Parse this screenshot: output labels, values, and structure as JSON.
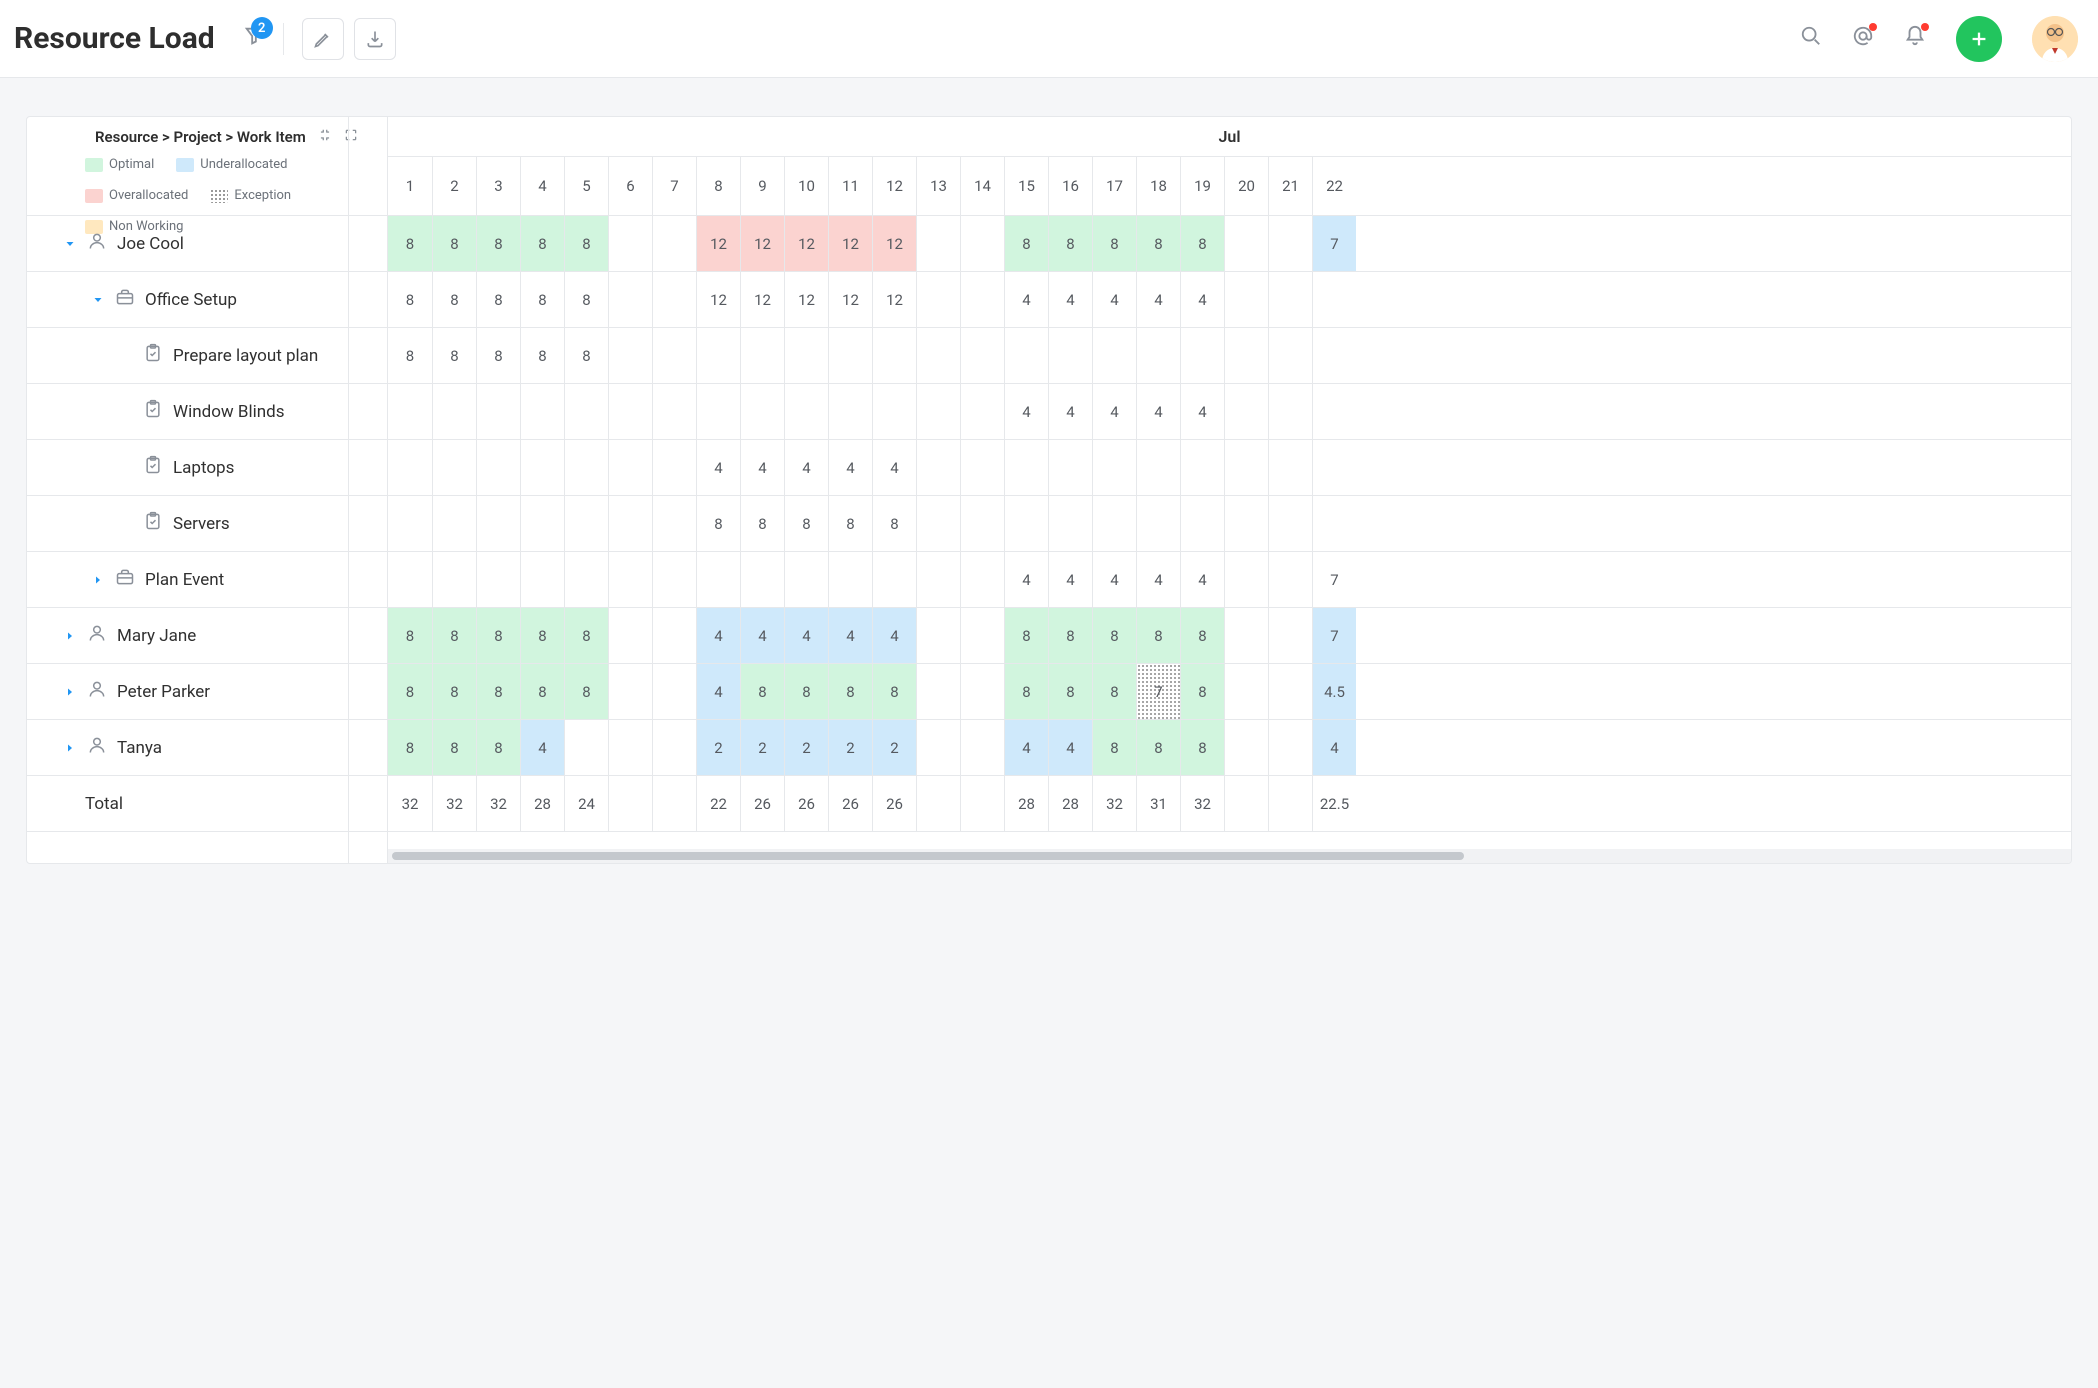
{
  "header": {
    "title": "Resource Load",
    "filter_count": "2"
  },
  "legend": {
    "breadcrumb": "Resource > Project > Work Item",
    "optimal": "Optimal",
    "under": "Underallocated",
    "over": "Overallocated",
    "exception": "Exception",
    "nonworking": "Non Working"
  },
  "calendar": {
    "month": "Jul",
    "days": [
      "1",
      "2",
      "3",
      "4",
      "5",
      "6",
      "7",
      "8",
      "9",
      "10",
      "11",
      "12",
      "13",
      "14",
      "15",
      "16",
      "17",
      "18",
      "19",
      "20",
      "21",
      "22"
    ]
  },
  "rows": [
    {
      "id": "joe",
      "label": "Joe Cool",
      "indent": 0,
      "icon": "person",
      "caret": "down",
      "cells": [
        {
          "v": "8",
          "s": "optimal"
        },
        {
          "v": "8",
          "s": "optimal"
        },
        {
          "v": "8",
          "s": "optimal"
        },
        {
          "v": "8",
          "s": "optimal"
        },
        {
          "v": "8",
          "s": "optimal"
        },
        {
          "v": ""
        },
        {
          "v": ""
        },
        {
          "v": "12",
          "s": "over"
        },
        {
          "v": "12",
          "s": "over"
        },
        {
          "v": "12",
          "s": "over"
        },
        {
          "v": "12",
          "s": "over"
        },
        {
          "v": "12",
          "s": "over"
        },
        {
          "v": ""
        },
        {
          "v": ""
        },
        {
          "v": "8",
          "s": "optimal"
        },
        {
          "v": "8",
          "s": "optimal"
        },
        {
          "v": "8",
          "s": "optimal"
        },
        {
          "v": "8",
          "s": "optimal"
        },
        {
          "v": "8",
          "s": "optimal"
        },
        {
          "v": ""
        },
        {
          "v": ""
        },
        {
          "v": "7",
          "s": "under"
        }
      ]
    },
    {
      "id": "office-setup",
      "label": "Office Setup",
      "indent": 1,
      "icon": "briefcase",
      "caret": "down",
      "cells": [
        {
          "v": "8"
        },
        {
          "v": "8"
        },
        {
          "v": "8"
        },
        {
          "v": "8"
        },
        {
          "v": "8"
        },
        {
          "v": ""
        },
        {
          "v": ""
        },
        {
          "v": "12"
        },
        {
          "v": "12"
        },
        {
          "v": "12"
        },
        {
          "v": "12"
        },
        {
          "v": "12"
        },
        {
          "v": ""
        },
        {
          "v": ""
        },
        {
          "v": "4"
        },
        {
          "v": "4"
        },
        {
          "v": "4"
        },
        {
          "v": "4"
        },
        {
          "v": "4"
        },
        {
          "v": ""
        },
        {
          "v": ""
        },
        {
          "v": ""
        }
      ]
    },
    {
      "id": "prepare-layout",
      "label": "Prepare layout plan",
      "indent": 2,
      "icon": "task",
      "caret": "",
      "cells": [
        {
          "v": "8"
        },
        {
          "v": "8"
        },
        {
          "v": "8"
        },
        {
          "v": "8"
        },
        {
          "v": "8"
        },
        {
          "v": ""
        },
        {
          "v": ""
        },
        {
          "v": ""
        },
        {
          "v": ""
        },
        {
          "v": ""
        },
        {
          "v": ""
        },
        {
          "v": ""
        },
        {
          "v": ""
        },
        {
          "v": ""
        },
        {
          "v": ""
        },
        {
          "v": ""
        },
        {
          "v": ""
        },
        {
          "v": ""
        },
        {
          "v": ""
        },
        {
          "v": ""
        },
        {
          "v": ""
        },
        {
          "v": ""
        }
      ]
    },
    {
      "id": "window-blinds",
      "label": "Window Blinds",
      "indent": 2,
      "icon": "task",
      "caret": "",
      "cells": [
        {
          "v": ""
        },
        {
          "v": ""
        },
        {
          "v": ""
        },
        {
          "v": ""
        },
        {
          "v": ""
        },
        {
          "v": ""
        },
        {
          "v": ""
        },
        {
          "v": ""
        },
        {
          "v": ""
        },
        {
          "v": ""
        },
        {
          "v": ""
        },
        {
          "v": ""
        },
        {
          "v": ""
        },
        {
          "v": ""
        },
        {
          "v": "4"
        },
        {
          "v": "4"
        },
        {
          "v": "4"
        },
        {
          "v": "4"
        },
        {
          "v": "4"
        },
        {
          "v": ""
        },
        {
          "v": ""
        },
        {
          "v": ""
        }
      ]
    },
    {
      "id": "laptops",
      "label": "Laptops",
      "indent": 2,
      "icon": "task",
      "caret": "",
      "cells": [
        {
          "v": ""
        },
        {
          "v": ""
        },
        {
          "v": ""
        },
        {
          "v": ""
        },
        {
          "v": ""
        },
        {
          "v": ""
        },
        {
          "v": ""
        },
        {
          "v": "4"
        },
        {
          "v": "4"
        },
        {
          "v": "4"
        },
        {
          "v": "4"
        },
        {
          "v": "4"
        },
        {
          "v": ""
        },
        {
          "v": ""
        },
        {
          "v": ""
        },
        {
          "v": ""
        },
        {
          "v": ""
        },
        {
          "v": ""
        },
        {
          "v": ""
        },
        {
          "v": ""
        },
        {
          "v": ""
        },
        {
          "v": ""
        }
      ]
    },
    {
      "id": "servers",
      "label": "Servers",
      "indent": 2,
      "icon": "task",
      "caret": "",
      "cells": [
        {
          "v": ""
        },
        {
          "v": ""
        },
        {
          "v": ""
        },
        {
          "v": ""
        },
        {
          "v": ""
        },
        {
          "v": ""
        },
        {
          "v": ""
        },
        {
          "v": "8"
        },
        {
          "v": "8"
        },
        {
          "v": "8"
        },
        {
          "v": "8"
        },
        {
          "v": "8"
        },
        {
          "v": ""
        },
        {
          "v": ""
        },
        {
          "v": ""
        },
        {
          "v": ""
        },
        {
          "v": ""
        },
        {
          "v": ""
        },
        {
          "v": ""
        },
        {
          "v": ""
        },
        {
          "v": ""
        },
        {
          "v": ""
        }
      ]
    },
    {
      "id": "plan-event",
      "label": "Plan Event",
      "indent": 1,
      "icon": "briefcase",
      "caret": "right",
      "cells": [
        {
          "v": ""
        },
        {
          "v": ""
        },
        {
          "v": ""
        },
        {
          "v": ""
        },
        {
          "v": ""
        },
        {
          "v": ""
        },
        {
          "v": ""
        },
        {
          "v": ""
        },
        {
          "v": ""
        },
        {
          "v": ""
        },
        {
          "v": ""
        },
        {
          "v": ""
        },
        {
          "v": ""
        },
        {
          "v": ""
        },
        {
          "v": "4"
        },
        {
          "v": "4"
        },
        {
          "v": "4"
        },
        {
          "v": "4"
        },
        {
          "v": "4"
        },
        {
          "v": ""
        },
        {
          "v": ""
        },
        {
          "v": "7"
        }
      ]
    },
    {
      "id": "mary-jane",
      "label": "Mary Jane",
      "indent": 0,
      "icon": "person",
      "caret": "right",
      "cells": [
        {
          "v": "8",
          "s": "optimal"
        },
        {
          "v": "8",
          "s": "optimal"
        },
        {
          "v": "8",
          "s": "optimal"
        },
        {
          "v": "8",
          "s": "optimal"
        },
        {
          "v": "8",
          "s": "optimal"
        },
        {
          "v": ""
        },
        {
          "v": ""
        },
        {
          "v": "4",
          "s": "under"
        },
        {
          "v": "4",
          "s": "under"
        },
        {
          "v": "4",
          "s": "under"
        },
        {
          "v": "4",
          "s": "under"
        },
        {
          "v": "4",
          "s": "under"
        },
        {
          "v": ""
        },
        {
          "v": ""
        },
        {
          "v": "8",
          "s": "optimal"
        },
        {
          "v": "8",
          "s": "optimal"
        },
        {
          "v": "8",
          "s": "optimal"
        },
        {
          "v": "8",
          "s": "optimal"
        },
        {
          "v": "8",
          "s": "optimal"
        },
        {
          "v": ""
        },
        {
          "v": ""
        },
        {
          "v": "7",
          "s": "under"
        }
      ]
    },
    {
      "id": "peter-parker",
      "label": "Peter Parker",
      "indent": 0,
      "icon": "person",
      "caret": "right",
      "cells": [
        {
          "v": "8",
          "s": "optimal"
        },
        {
          "v": "8",
          "s": "optimal"
        },
        {
          "v": "8",
          "s": "optimal"
        },
        {
          "v": "8",
          "s": "optimal"
        },
        {
          "v": "8",
          "s": "optimal"
        },
        {
          "v": ""
        },
        {
          "v": ""
        },
        {
          "v": "4",
          "s": "under"
        },
        {
          "v": "8",
          "s": "optimal"
        },
        {
          "v": "8",
          "s": "optimal"
        },
        {
          "v": "8",
          "s": "optimal"
        },
        {
          "v": "8",
          "s": "optimal"
        },
        {
          "v": ""
        },
        {
          "v": ""
        },
        {
          "v": "8",
          "s": "optimal"
        },
        {
          "v": "8",
          "s": "optimal"
        },
        {
          "v": "8",
          "s": "optimal"
        },
        {
          "v": "7",
          "s": "exception"
        },
        {
          "v": "8",
          "s": "optimal"
        },
        {
          "v": ""
        },
        {
          "v": ""
        },
        {
          "v": "4.5",
          "s": "under"
        }
      ]
    },
    {
      "id": "tanya",
      "label": "Tanya",
      "indent": 0,
      "icon": "person",
      "caret": "right",
      "cells": [
        {
          "v": "8",
          "s": "optimal"
        },
        {
          "v": "8",
          "s": "optimal"
        },
        {
          "v": "8",
          "s": "optimal"
        },
        {
          "v": "4",
          "s": "under"
        },
        {
          "v": ""
        },
        {
          "v": ""
        },
        {
          "v": ""
        },
        {
          "v": "2",
          "s": "under"
        },
        {
          "v": "2",
          "s": "under"
        },
        {
          "v": "2",
          "s": "under"
        },
        {
          "v": "2",
          "s": "under"
        },
        {
          "v": "2",
          "s": "under"
        },
        {
          "v": ""
        },
        {
          "v": ""
        },
        {
          "v": "4",
          "s": "under"
        },
        {
          "v": "4",
          "s": "under"
        },
        {
          "v": "8",
          "s": "optimal"
        },
        {
          "v": "8",
          "s": "optimal"
        },
        {
          "v": "8",
          "s": "optimal"
        },
        {
          "v": ""
        },
        {
          "v": ""
        },
        {
          "v": "4",
          "s": "under"
        }
      ]
    },
    {
      "id": "total",
      "label": "Total",
      "indent": 0,
      "icon": "",
      "caret": "",
      "cells": [
        {
          "v": "32"
        },
        {
          "v": "32"
        },
        {
          "v": "32"
        },
        {
          "v": "28"
        },
        {
          "v": "24"
        },
        {
          "v": ""
        },
        {
          "v": ""
        },
        {
          "v": "22"
        },
        {
          "v": "26"
        },
        {
          "v": "26"
        },
        {
          "v": "26"
        },
        {
          "v": "26"
        },
        {
          "v": ""
        },
        {
          "v": ""
        },
        {
          "v": "28"
        },
        {
          "v": "28"
        },
        {
          "v": "32"
        },
        {
          "v": "31"
        },
        {
          "v": "32"
        },
        {
          "v": ""
        },
        {
          "v": ""
        },
        {
          "v": "22.5"
        }
      ]
    }
  ]
}
